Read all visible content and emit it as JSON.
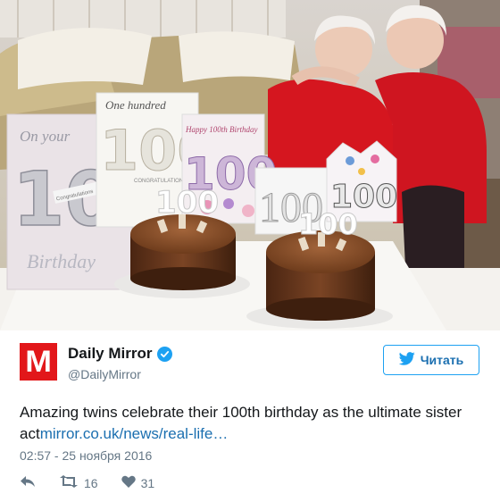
{
  "tweet": {
    "account_name": "Daily Mirror",
    "handle": "@DailyMirror",
    "avatar_letter": "M",
    "follow_label": "Читать",
    "text": "Amazing twins celebrate their 100th birthday as the ultimate sister act",
    "link_text": "mirror.co.uk/news/real-life…",
    "timestamp": "02:57 - 25 ноября 2016",
    "retweet_count": "16",
    "like_count": "31"
  },
  "photo": {
    "card_cover_line1": "On your",
    "card_cover_number": "100",
    "card_cover_line2": "Birthday",
    "card_cover_tag": "Congratulations",
    "card_center_line": "One hundred",
    "card_center_number": "100",
    "card_center_congrats": "CONGRATULATIONS",
    "card_pink_line": "Happy 100th Birthday",
    "card_pink_number": "100",
    "card_right_number": "100",
    "card_small_number": "100",
    "cake_left_topper": "100",
    "cake_right_topper": "100"
  },
  "icons": {
    "verified": "verified-badge-icon",
    "bird": "twitter-bird-icon",
    "reply": "reply-icon",
    "retweet": "retweet-icon",
    "like": "heart-icon"
  },
  "colors": {
    "brand_red": "#e2171a",
    "twitter_blue": "#1da1f2",
    "link_blue": "#1b6fb0",
    "muted_gray": "#657786"
  }
}
